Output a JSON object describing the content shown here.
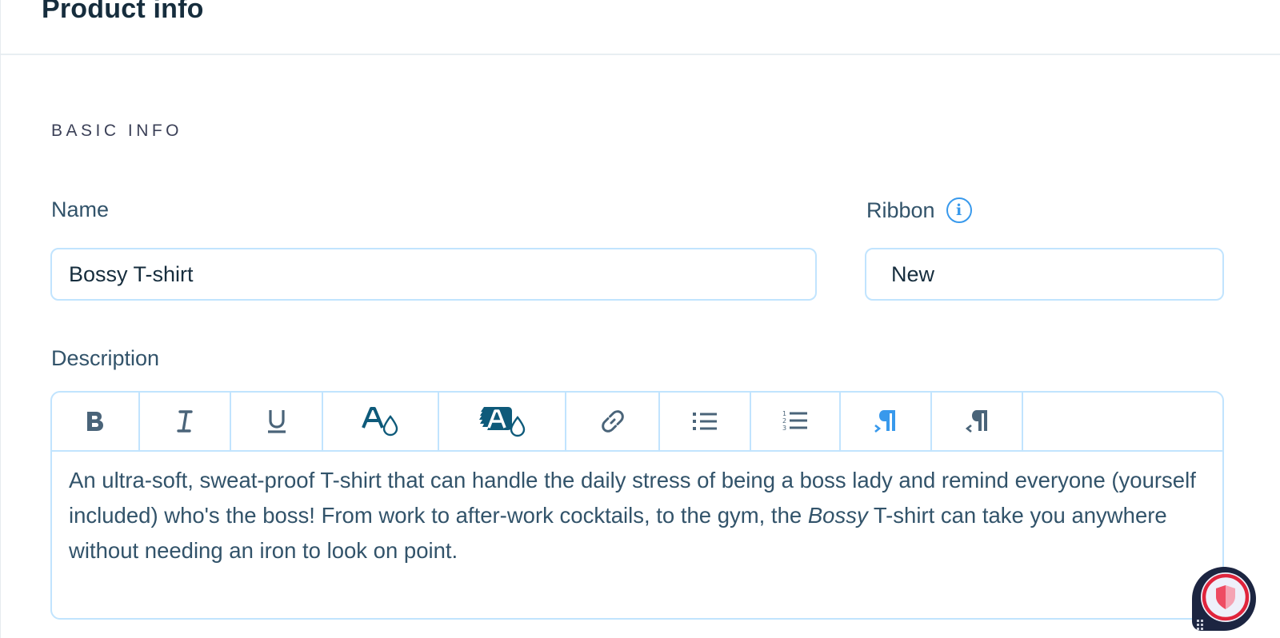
{
  "header": {
    "title": "Product info"
  },
  "section": {
    "title": "BASIC INFO"
  },
  "fields": {
    "name": {
      "label": "Name",
      "value": "Bossy T-shirt"
    },
    "ribbon": {
      "label": "Ribbon",
      "value": "New",
      "info_icon": "i"
    },
    "description": {
      "label": "Description",
      "text_before": "An ultra-soft, sweat-proof T-shirt that can handle the daily stress of being a boss lady and remind everyone (yourself included) who's the boss! From work to after-work cocktails, to the gym, the ",
      "text_italic": "Bossy",
      "text_after": " T-shirt can take you anywhere without needing an iron to look on point."
    }
  },
  "toolbar": {
    "buttons": [
      {
        "name": "bold",
        "icon": "bold-icon"
      },
      {
        "name": "italic",
        "icon": "italic-icon"
      },
      {
        "name": "underline",
        "icon": "underline-icon"
      },
      {
        "name": "text-color",
        "icon": "text-color-icon"
      },
      {
        "name": "highlight-color",
        "icon": "highlight-color-icon"
      },
      {
        "name": "link",
        "icon": "link-icon"
      },
      {
        "name": "bulleted-list",
        "icon": "bulleted-list-icon"
      },
      {
        "name": "numbered-list",
        "icon": "numbered-list-icon"
      },
      {
        "name": "ltr-direction",
        "icon": "ltr-paragraph-icon"
      },
      {
        "name": "rtl-direction",
        "icon": "rtl-paragraph-icon"
      }
    ]
  },
  "colors": {
    "primary_text": "#162d3d",
    "secondary_text": "#32536a",
    "border": "#c1e4fe",
    "accent_blue": "#3899ec",
    "icon_gray": "#4a6479",
    "icon_teal": "#0e5a7a",
    "badge_red": "#e0243c",
    "badge_dark": "#1c2541"
  },
  "widget": {
    "icon": "shield-icon"
  }
}
